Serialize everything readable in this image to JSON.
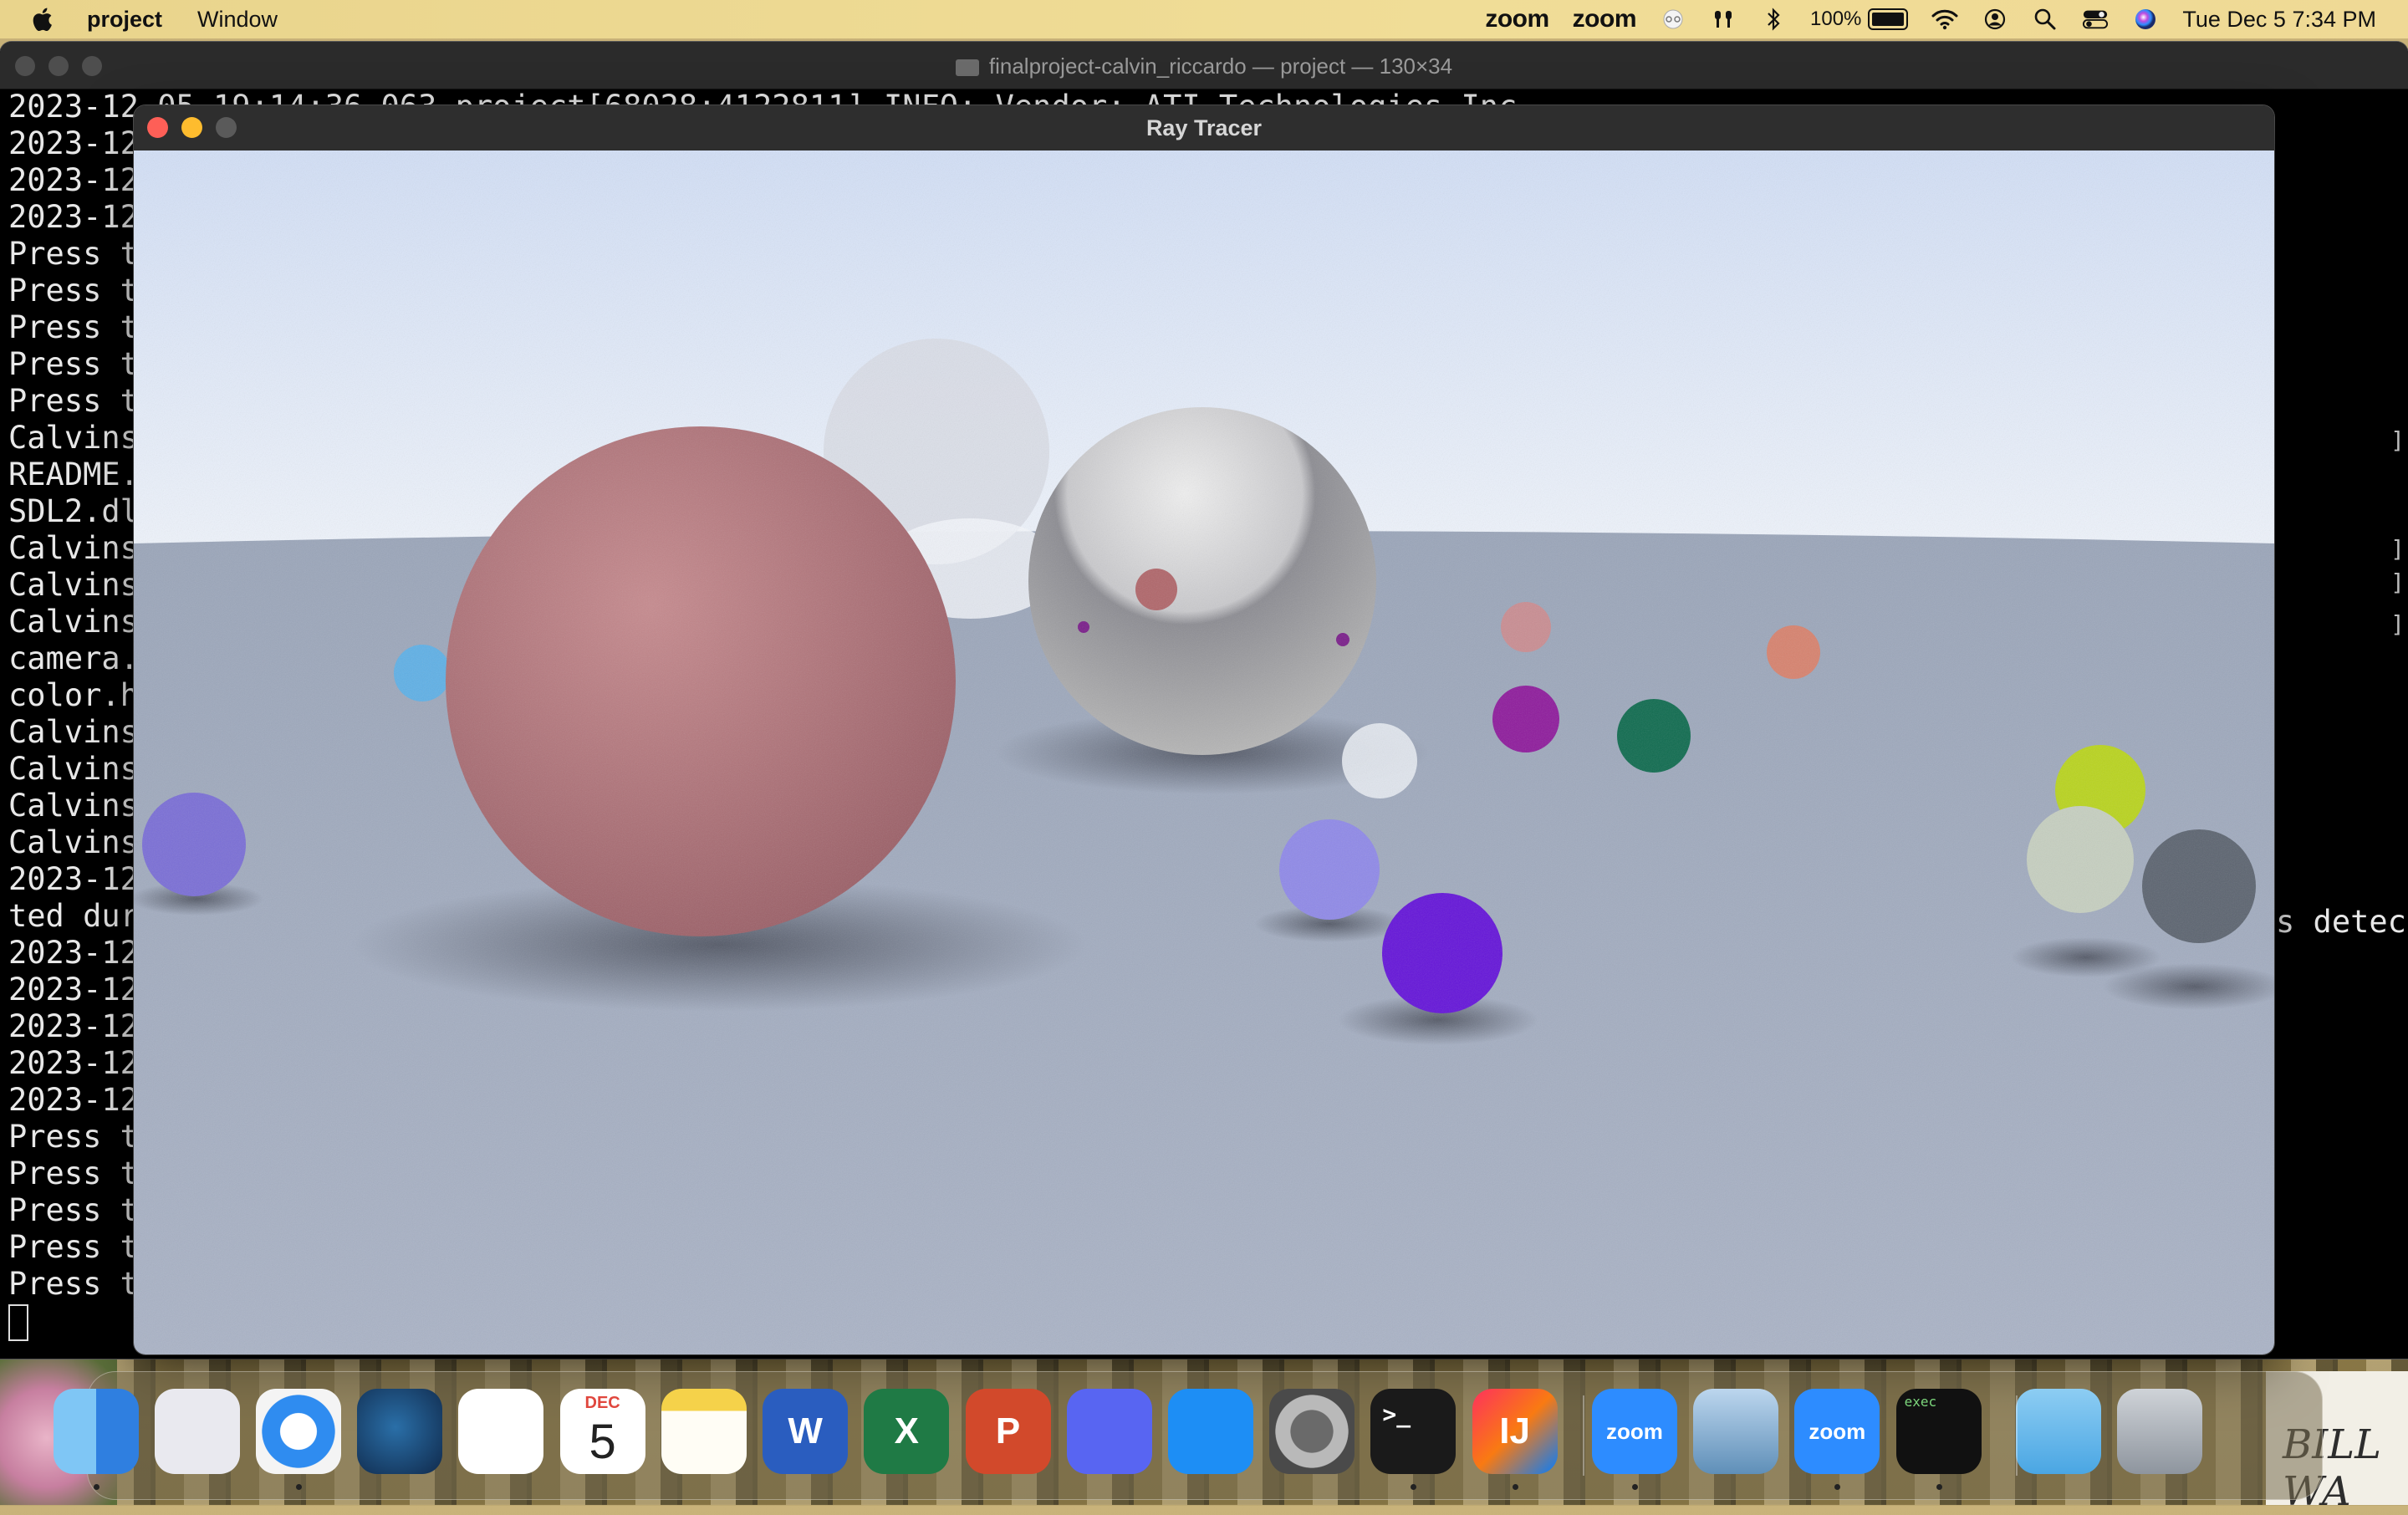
{
  "menubar": {
    "app_name": "project",
    "items": [
      "Window"
    ],
    "status": {
      "zoom1": "zoom",
      "zoom2": "zoom",
      "battery": "100%",
      "clock": "Tue Dec 5  7:34 PM"
    }
  },
  "terminal": {
    "title": "finalproject-calvin_riccardo — project — 130×34",
    "lines": [
      "2023-12-05 19:14:36.063 project[68028:4122811] INFO: Vendor: ATI Technologies Inc.",
      "2023-12",
      "2023-12",
      "2023-12",
      "Press t",
      "Press t",
      "Press t",
      "Press t",
      "Press t",
      "Calvins",
      "README.",
      "SDL2.dl",
      "Calvins",
      "Calvins",
      "Calvins",
      "camera.",
      "color.h",
      "Calvins",
      "Calvins",
      "Calvins",
      "Calvins",
      "2023-12",
      "ted dur",
      "2023-12",
      "2023-12",
      "2023-12",
      "2023-12",
      "2023-12",
      "Press t",
      "Press t",
      "Press t",
      "Press t",
      "Press t"
    ],
    "right_fragment": "s detec"
  },
  "raytracer": {
    "title": "Ray Tracer",
    "colors": {
      "sky_top": "#d4e0f5",
      "sky_horizon": "#eef3fa",
      "ground": "#a7b1c4",
      "close": "#fe5f57",
      "minimize": "#febc2e",
      "zoom": "#5a5a5a"
    }
  },
  "dock": {
    "items": [
      {
        "name": "finder-icon",
        "label": "",
        "running": true
      },
      {
        "name": "launchpad-icon",
        "label": "",
        "running": false
      },
      {
        "name": "safari-icon",
        "label": "",
        "running": true
      },
      {
        "name": "steam-icon",
        "label": "",
        "running": false
      },
      {
        "name": "reminders-icon",
        "label": "",
        "running": false
      },
      {
        "name": "calendar-icon",
        "label": "DEC",
        "running": false
      },
      {
        "name": "notes-icon",
        "label": "",
        "running": false
      },
      {
        "name": "word-icon",
        "label": "W",
        "running": false
      },
      {
        "name": "excel-icon",
        "label": "X",
        "running": false
      },
      {
        "name": "powerpoint-icon",
        "label": "P",
        "running": false
      },
      {
        "name": "discord-icon",
        "label": "",
        "running": false
      },
      {
        "name": "app-store-icon",
        "label": "",
        "running": false
      },
      {
        "name": "system-settings-icon",
        "label": "",
        "running": false
      },
      {
        "name": "terminal-icon",
        "label": ">_",
        "running": true
      },
      {
        "name": "intellij-icon",
        "label": "IJ",
        "running": true
      },
      {
        "name": "zoom-icon",
        "label": "zoom",
        "running": true
      },
      {
        "name": "preview-icon",
        "label": "",
        "running": false
      },
      {
        "name": "zoom-2-icon",
        "label": "zoom",
        "running": true
      },
      {
        "name": "exec-icon",
        "label": "exec",
        "running": true
      },
      {
        "name": "downloads-icon",
        "label": "",
        "running": false
      },
      {
        "name": "trash-icon",
        "label": "",
        "running": false
      }
    ],
    "calendar_day": "5"
  },
  "wallpaper_text": "BILL WA"
}
